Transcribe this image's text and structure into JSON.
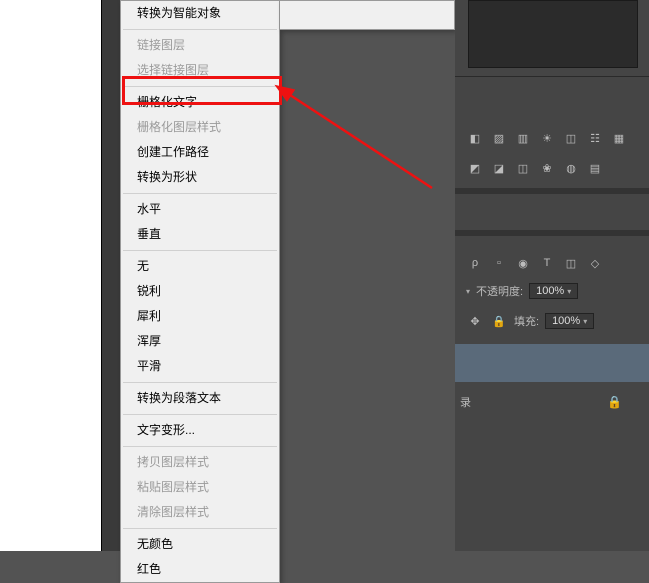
{
  "menu": {
    "convert_smart": "转换为智能对象",
    "link_layers": "链接图层",
    "select_linked": "选择链接图层",
    "rasterize_type": "栅格化文字",
    "rasterize_style": "栅格化图层样式",
    "create_path": "创建工作路径",
    "convert_shape": "转换为形状",
    "horizontal": "水平",
    "vertical": "垂直",
    "none": "无",
    "sharp": "锐利",
    "crisp": "犀利",
    "strong": "浑厚",
    "smooth": "平滑",
    "paragraph": "转换为段落文本",
    "warp": "文字变形...",
    "copy_style": "拷贝图层样式",
    "paste_style": "粘贴图层样式",
    "clear_style": "清除图层样式",
    "no_color": "无颜色",
    "red": "红色"
  },
  "panel": {
    "opacity_label": "不透明度:",
    "opacity_value": "100%",
    "fill_label": "填充:",
    "fill_value": "100%",
    "row_suffix": "录"
  }
}
